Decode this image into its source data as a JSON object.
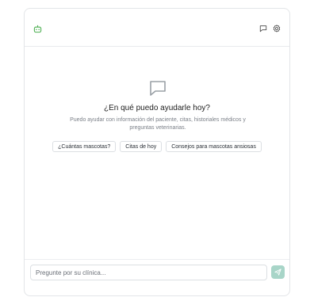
{
  "header": {
    "logo_icon": "bot-icon",
    "actions": [
      {
        "name": "chat-icon"
      },
      {
        "name": "gear-icon"
      }
    ]
  },
  "empty_state": {
    "icon": "message-square-icon",
    "title": "¿En qué puedo ayudarle hoy?",
    "subtitle": "Puedo ayudar con información del paciente, citas, historiales médicos y preguntas veterinarias.",
    "suggestions": [
      "¿Cuántas mascotas?",
      "Citas de hoy",
      "Consejos para mascotas ansiosas"
    ]
  },
  "composer": {
    "placeholder": "Pregunte por su clínica...",
    "value": "",
    "send_icon": "send-icon"
  },
  "colors": {
    "accent": "#4caf50",
    "send_bg": "#a8d5c8",
    "border": "#e3e5e8",
    "muted_text": "#7a7f87"
  }
}
